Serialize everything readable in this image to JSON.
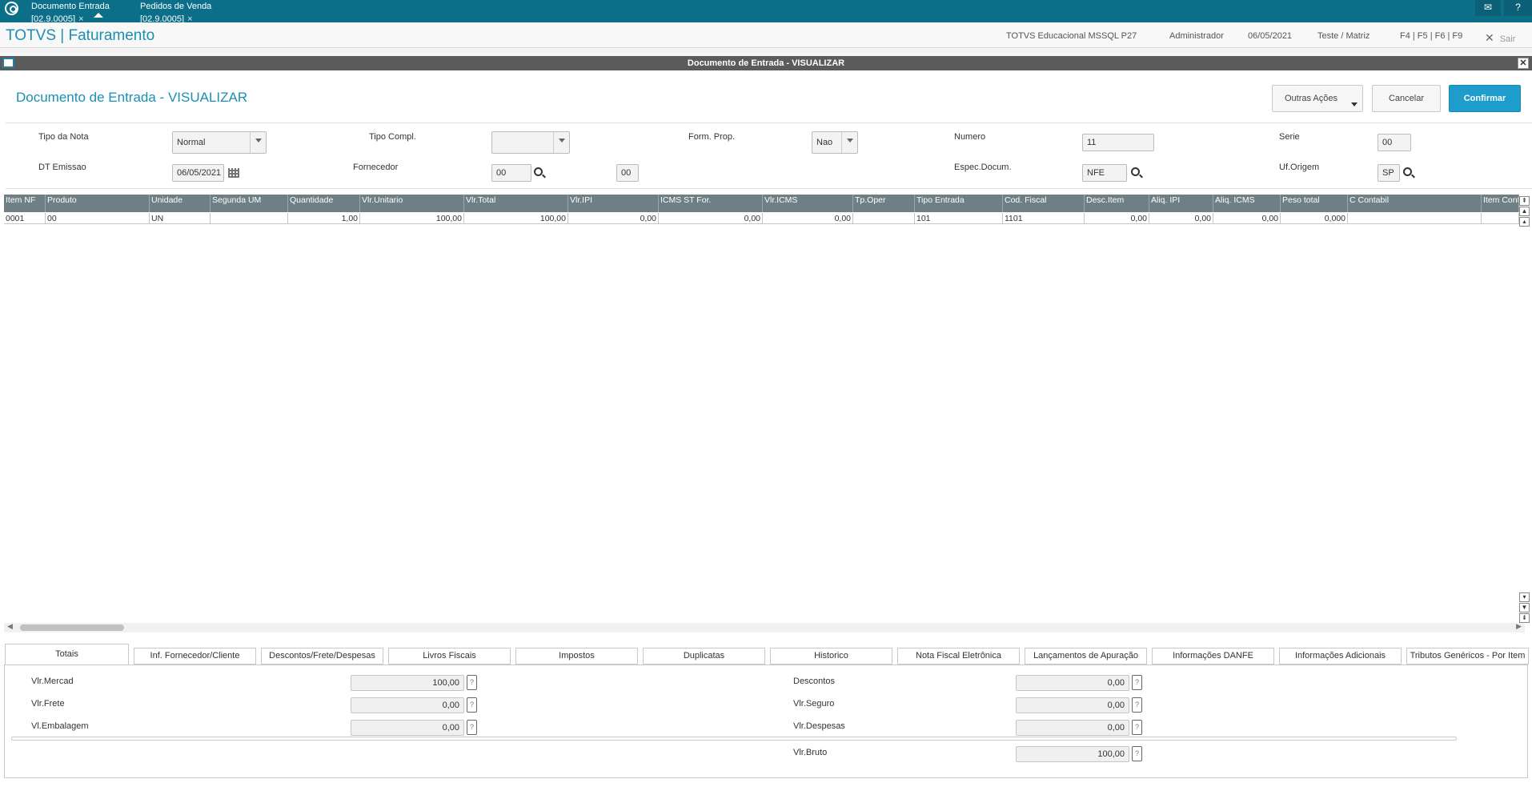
{
  "topbar": {
    "tabs": [
      {
        "label": "Documento Entrada [02.9.0005]"
      },
      {
        "label": "Pedidos de Venda [02.9.0005]"
      }
    ],
    "close_glyph": "×"
  },
  "header": {
    "title": "TOTVS | Faturamento",
    "environment": "TOTVS Educacional MSSQL P27",
    "user": "Administrador",
    "date": "06/05/2021",
    "branch": "Teste / Matriz",
    "shortcuts": "F4 | F5 | F6 | F9",
    "exit": "Sair"
  },
  "window": {
    "title": "Documento de Entrada - VISUALIZAR",
    "heading": "Documento de Entrada - VISUALIZAR"
  },
  "actions": {
    "other": "Outras Ações",
    "cancel": "Cancelar",
    "confirm": "Confirmar"
  },
  "form": {
    "tipo_nota_label": "Tipo da Nota",
    "tipo_nota_value": "Normal",
    "tipo_compl_label": "Tipo Compl.",
    "tipo_compl_value": "",
    "form_prop_label": "Form. Prop.",
    "form_prop_value": "Nao",
    "numero_label": "Numero",
    "numero_value": "11",
    "serie_label": "Serie",
    "serie_value": "00",
    "dt_emissao_label": "DT Emissao",
    "dt_emissao_value": "06/05/2021",
    "fornecedor_label": "Fornecedor",
    "fornecedor_value": "00",
    "loja_value": "00",
    "espec_label": "Espec.Docum.",
    "espec_value": "NFE",
    "uf_label": "Uf.Origem",
    "uf_value": "SP"
  },
  "grid": {
    "columns": [
      "Item NF",
      "Produto",
      "Unidade",
      "Segunda UM",
      "Quantidade",
      "Vlr.Unitario",
      "Vlr.Total",
      "Vlr.IPI",
      "ICMS ST For.",
      "Vlr.ICMS",
      "Tp.Oper",
      "Tipo Entrada",
      "Cod. Fiscal",
      "Desc.Item",
      "Aliq. IPI",
      "Aliq. ICMS",
      "Peso total",
      "C Contabil",
      "Item Conta"
    ],
    "rows": [
      [
        "0001",
        "00",
        "UN",
        "",
        "1,00",
        "100,00",
        "100,00",
        "0,00",
        "0,00",
        "0,00",
        "",
        "101",
        "1101",
        "0,00",
        "0,00",
        "0,00",
        "0,000",
        "",
        ""
      ]
    ]
  },
  "tabs": [
    "Totais",
    "Inf. Fornecedor/Cliente",
    "Descontos/Frete/Despesas",
    "Livros Fiscais",
    "Impostos",
    "Duplicatas",
    "Historico",
    "Nota Fiscal Eletrônica",
    "Lançamentos de Apuração",
    "Informações DANFE",
    "Informações Adicionais",
    "Tributos Genéricos - Por Item"
  ],
  "totals": {
    "vlr_mercad_label": "Vlr.Mercad",
    "vlr_mercad_value": "100,00",
    "vlr_frete_label": "Vlr.Frete",
    "vlr_frete_value": "0,00",
    "vl_embalagem_label": "Vl.Embalagem",
    "vl_embalagem_value": "0,00",
    "descontos_label": "Descontos",
    "descontos_value": "0,00",
    "vlr_seguro_label": "Vlr.Seguro",
    "vlr_seguro_value": "0,00",
    "vlr_despesas_label": "Vlr.Despesas",
    "vlr_despesas_value": "0,00",
    "vlr_bruto_label": "Vlr.Bruto",
    "vlr_bruto_value": "100,00",
    "help_glyph": "?"
  }
}
